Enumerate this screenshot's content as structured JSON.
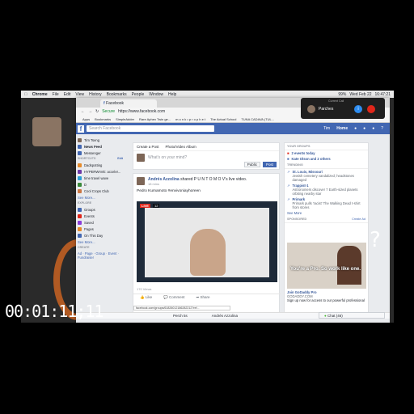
{
  "menubar": {
    "app": "Chrome",
    "items": [
      "File",
      "Edit",
      "View",
      "History",
      "Bookmarks",
      "People",
      "Window",
      "Help"
    ],
    "status": [
      "99%",
      "Wed Feb 22",
      "16:47:21"
    ]
  },
  "browser": {
    "tab_title": "Facebook",
    "secure_label": "Secure",
    "url": "https://www.facebook.com",
    "bookmarks": [
      "Apps",
      "Bookmarks",
      "SimpleAdder",
      "Rare Aphex Twin ge...",
      "m o n k • p r o p h e t",
      "The Actual School",
      "TUNA CADAVA (TUL..."
    ]
  },
  "fb": {
    "search_placeholder": "Search Facebook",
    "nav_user": "Tim",
    "nav_home": "Home",
    "sidebar": {
      "profile": "Tim Tseng",
      "items": [
        "News Feed",
        "Messenger"
      ],
      "shortcuts_hdr": "SHORTCUTS",
      "shortcuts_edit": "Edit",
      "shortcuts": [
        "Dadspotting",
        "HYPERWAVE: acceler...",
        "time travel wave",
        "D",
        "Cool Crops Club"
      ],
      "see_more": "See More...",
      "explore_hdr": "EXPLORE",
      "explore": [
        "Groups",
        "Events",
        "Saved",
        "Pages",
        "On This Day"
      ],
      "create_hdr": "CREATE",
      "create_links": "Ad · Page · Group · Event · Fundraiser"
    },
    "composer": {
      "tab_post": "Create a Post",
      "tab_photo": "Photo/Video Album",
      "placeholder": "What's on your mind?",
      "audience": "Public",
      "post_btn": "Post"
    },
    "post": {
      "author": "Andrés Azzolina",
      "action": "shared P U N T O M O V's live video.",
      "time": "18 mins",
      "text": "Pedro Kumamoto #envivoniayhoreen",
      "live": "LIVE",
      "views": "12",
      "counts": "170 Views",
      "like": "Like",
      "comment": "Comment",
      "share": "Share",
      "status_url": "facebook.com/groups/61826012186282212?ref..."
    },
    "right": {
      "groups_hdr": "YOUR GROUPS",
      "events_hdr": "",
      "events_count": "2 events today",
      "birthday": "Kate Olson and 2 others",
      "trending_hdr": "TRENDING",
      "trending": [
        {
          "title": "St. Louis, Missouri",
          "sub": "Jewish cemetery vandalized; headstones damaged"
        },
        {
          "title": "Trappist-1",
          "sub": "Astronomers discover 7 Earth-sized planets orbiting nearby star"
        },
        {
          "title": "Primark",
          "sub": "Primark pulls 'racist' The Walking Dead t-shirt from stores"
        }
      ],
      "see_more": "See More",
      "sponsored_hdr": "SPONSORED",
      "create_ad": "Create Ad",
      "ad_banner": "You're a Pro. So work like one.",
      "ad_title": "Join GoDaddy Pro",
      "ad_domain": "GODADDY.COM",
      "ad_text": "Sign up now for access to our powerful professional"
    },
    "statusbar": [
      "Perch 5s",
      "Andrés Azzolina"
    ],
    "chat": "Chat (46)"
  },
  "call": {
    "label": "Current Call",
    "name": "Parches",
    "info_glyph": "i"
  },
  "overlay": {
    "question": "?",
    "timecode": "00:01:11;11"
  }
}
